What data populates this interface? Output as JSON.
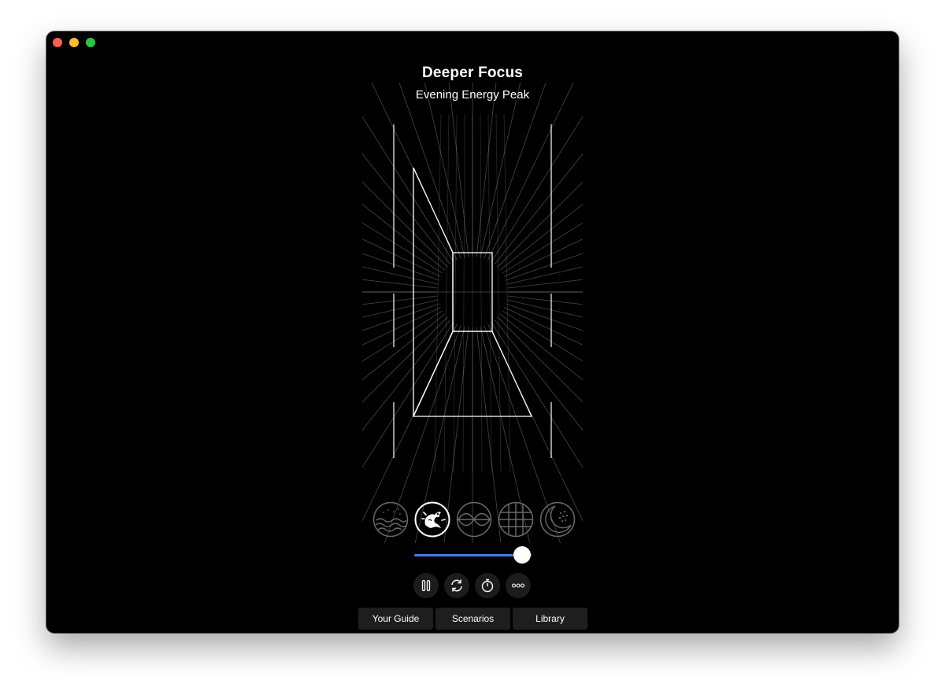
{
  "header": {
    "title": "Deeper Focus",
    "subtitle": "Evening Energy Peak"
  },
  "modes": [
    {
      "icon": "waves-icon",
      "selected": false
    },
    {
      "icon": "dragon-icon",
      "selected": true
    },
    {
      "icon": "sine-wave-icon",
      "selected": false
    },
    {
      "icon": "grid-globe-icon",
      "selected": false
    },
    {
      "icon": "moon-stars-icon",
      "selected": false
    }
  ],
  "volume": {
    "level": 0.91
  },
  "controls": [
    {
      "icon": "pause-icon"
    },
    {
      "icon": "repeat-icon"
    },
    {
      "icon": "timer-icon"
    },
    {
      "icon": "more-icon"
    }
  ],
  "tabs": [
    {
      "label": "Your Guide"
    },
    {
      "label": "Scenarios"
    },
    {
      "label": "Library"
    }
  ],
  "colors": {
    "background": "#000000",
    "accent": "#3f7bf0",
    "foreground": "#ffffff"
  }
}
